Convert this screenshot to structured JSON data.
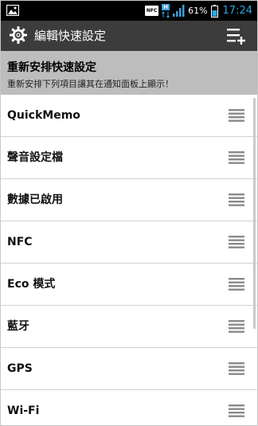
{
  "status_bar": {
    "nfc_label": "NFC",
    "network_type": "H",
    "battery_percent": "61%",
    "time": "17:24"
  },
  "action_bar": {
    "title": "編輯快速設定",
    "left_icon": "gear-icon",
    "right_icon": "add-list-icon"
  },
  "header": {
    "title": "重新安排快速設定",
    "subtitle": "重新安排下列項目讓其在通知面板上顯示！"
  },
  "items": [
    {
      "label": "QuickMemo"
    },
    {
      "label": "聲音設定檔"
    },
    {
      "label": "數據已啟用"
    },
    {
      "label": "NFC"
    },
    {
      "label": "Eco 模式"
    },
    {
      "label": "藍牙"
    },
    {
      "label": "GPS"
    },
    {
      "label": "Wi-Fi"
    }
  ],
  "colors": {
    "status_bar_bg": "#000000",
    "action_bar_bg": "#3c3c3c",
    "header_bg": "#bdbdbd",
    "clock": "#29a7e1",
    "battery_fill": "#29a7e1"
  }
}
